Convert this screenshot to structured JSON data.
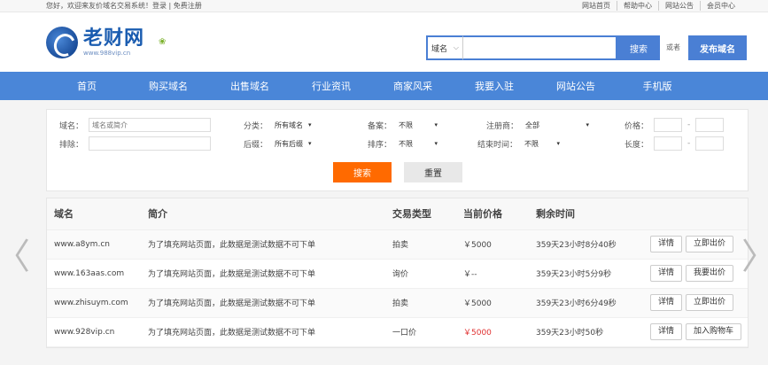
{
  "topbar": {
    "welcome": "您好，欢迎来友价域名交易系统！",
    "login": "登录",
    "register": "免费注册",
    "links": [
      "网站首页",
      "帮助中心",
      "网站公告",
      "会员中心"
    ]
  },
  "logo": {
    "title": "老财网",
    "sub": "www.988vip.cn"
  },
  "search": {
    "type": "域名",
    "placeholder": "",
    "button": "搜索"
  },
  "or_text": "或者",
  "publish": "发布域名",
  "nav": [
    "首页",
    "购买域名",
    "出售域名",
    "行业资讯",
    "商家风采",
    "我要入驻",
    "网站公告",
    "手机版"
  ],
  "filter": {
    "domain_label": "域名：",
    "domain_placeholder": "域名或简介",
    "category_label": "分类：",
    "category_value": "所有域名",
    "record_label": "备案：",
    "record_value": "不限",
    "registrar_label": "注册商：",
    "registrar_value": "全部",
    "price_label": "价格：",
    "exclude_label": "排除：",
    "suffix_label": "后缀：",
    "suffix_value": "所有后缀",
    "sort_label": "排序：",
    "sort_value": "不限",
    "endtime_label": "结束时间：",
    "endtime_value": "不限",
    "length_label": "长度：",
    "range_dash": "-",
    "search_btn": "搜索",
    "reset_btn": "重置"
  },
  "table": {
    "headers": [
      "域名",
      "简介",
      "交易类型",
      "当前价格",
      "剩余时间"
    ],
    "rows": [
      {
        "domain": "www.a8ym.cn",
        "desc": "为了填充网站页面，此数据是测试数据不可下单",
        "type": "拍卖",
        "price": "￥5000",
        "time": "359天23小时8分40秒",
        "a1": "详情",
        "a2": "立即出价"
      },
      {
        "domain": "www.163aas.com",
        "desc": "为了填充网站页面，此数据是测试数据不可下单",
        "type": "询价",
        "price": "￥--",
        "time": "359天23小时5分9秒",
        "a1": "详情",
        "a2": "我要出价"
      },
      {
        "domain": "www.zhisuym.com",
        "desc": "为了填充网站页面，此数据是测试数据不可下单",
        "type": "拍卖",
        "price": "￥5000",
        "time": "359天23小时6分49秒",
        "a1": "详情",
        "a2": "立即出价"
      },
      {
        "domain": "www.928vip.cn",
        "desc": "为了填充网站页面，此数据是测试数据不可下单",
        "type": "一口价",
        "price": "￥5000",
        "time": "359天23小时50秒",
        "a1": "详情",
        "a2": "加入购物车"
      }
    ]
  },
  "colors": {
    "brand": "#4a86d8",
    "orange": "#ff6a00",
    "price_red": "#e03030"
  },
  "arrows": {
    "left": "〈",
    "right": "〉"
  }
}
